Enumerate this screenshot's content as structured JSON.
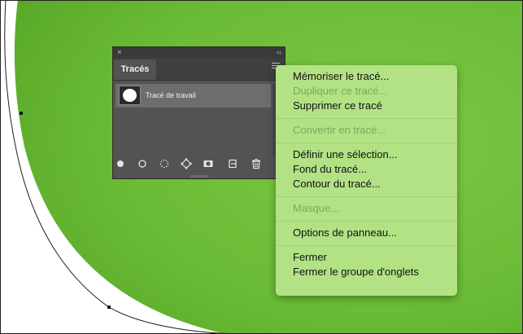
{
  "colors": {
    "canvas_green": "#6fbf3a",
    "panel_bg": "#535353",
    "menu_bg": "#b2e284",
    "menu_disabled_text": "#7da860"
  },
  "panel": {
    "close_glyph": "×",
    "collapse_glyph": "‹‹",
    "tab_label": "Tracés",
    "path_row": {
      "name": "Tracé de travail"
    },
    "footer_icons": [
      "fill-path-icon",
      "stroke-path-icon",
      "load-selection-icon",
      "make-work-path-icon",
      "add-mask-icon",
      "new-path-icon",
      "trash-icon"
    ]
  },
  "menu": {
    "items": [
      {
        "label": "Mémoriser le tracé...",
        "enabled": true
      },
      {
        "label": "Dupliquer ce tracé...",
        "enabled": false
      },
      {
        "label": "Supprimer ce tracé",
        "enabled": true
      },
      {
        "label": "Convertir en tracé...",
        "enabled": false
      },
      {
        "label": "Définir une sélection...",
        "enabled": true
      },
      {
        "label": "Fond du tracé...",
        "enabled": true
      },
      {
        "label": "Contour du tracé...",
        "enabled": true
      },
      {
        "label": "Masque...",
        "enabled": false
      },
      {
        "label": "Options de panneau...",
        "enabled": true
      },
      {
        "label": "Fermer",
        "enabled": true
      },
      {
        "label": "Fermer le groupe d'onglets",
        "enabled": true
      }
    ]
  }
}
